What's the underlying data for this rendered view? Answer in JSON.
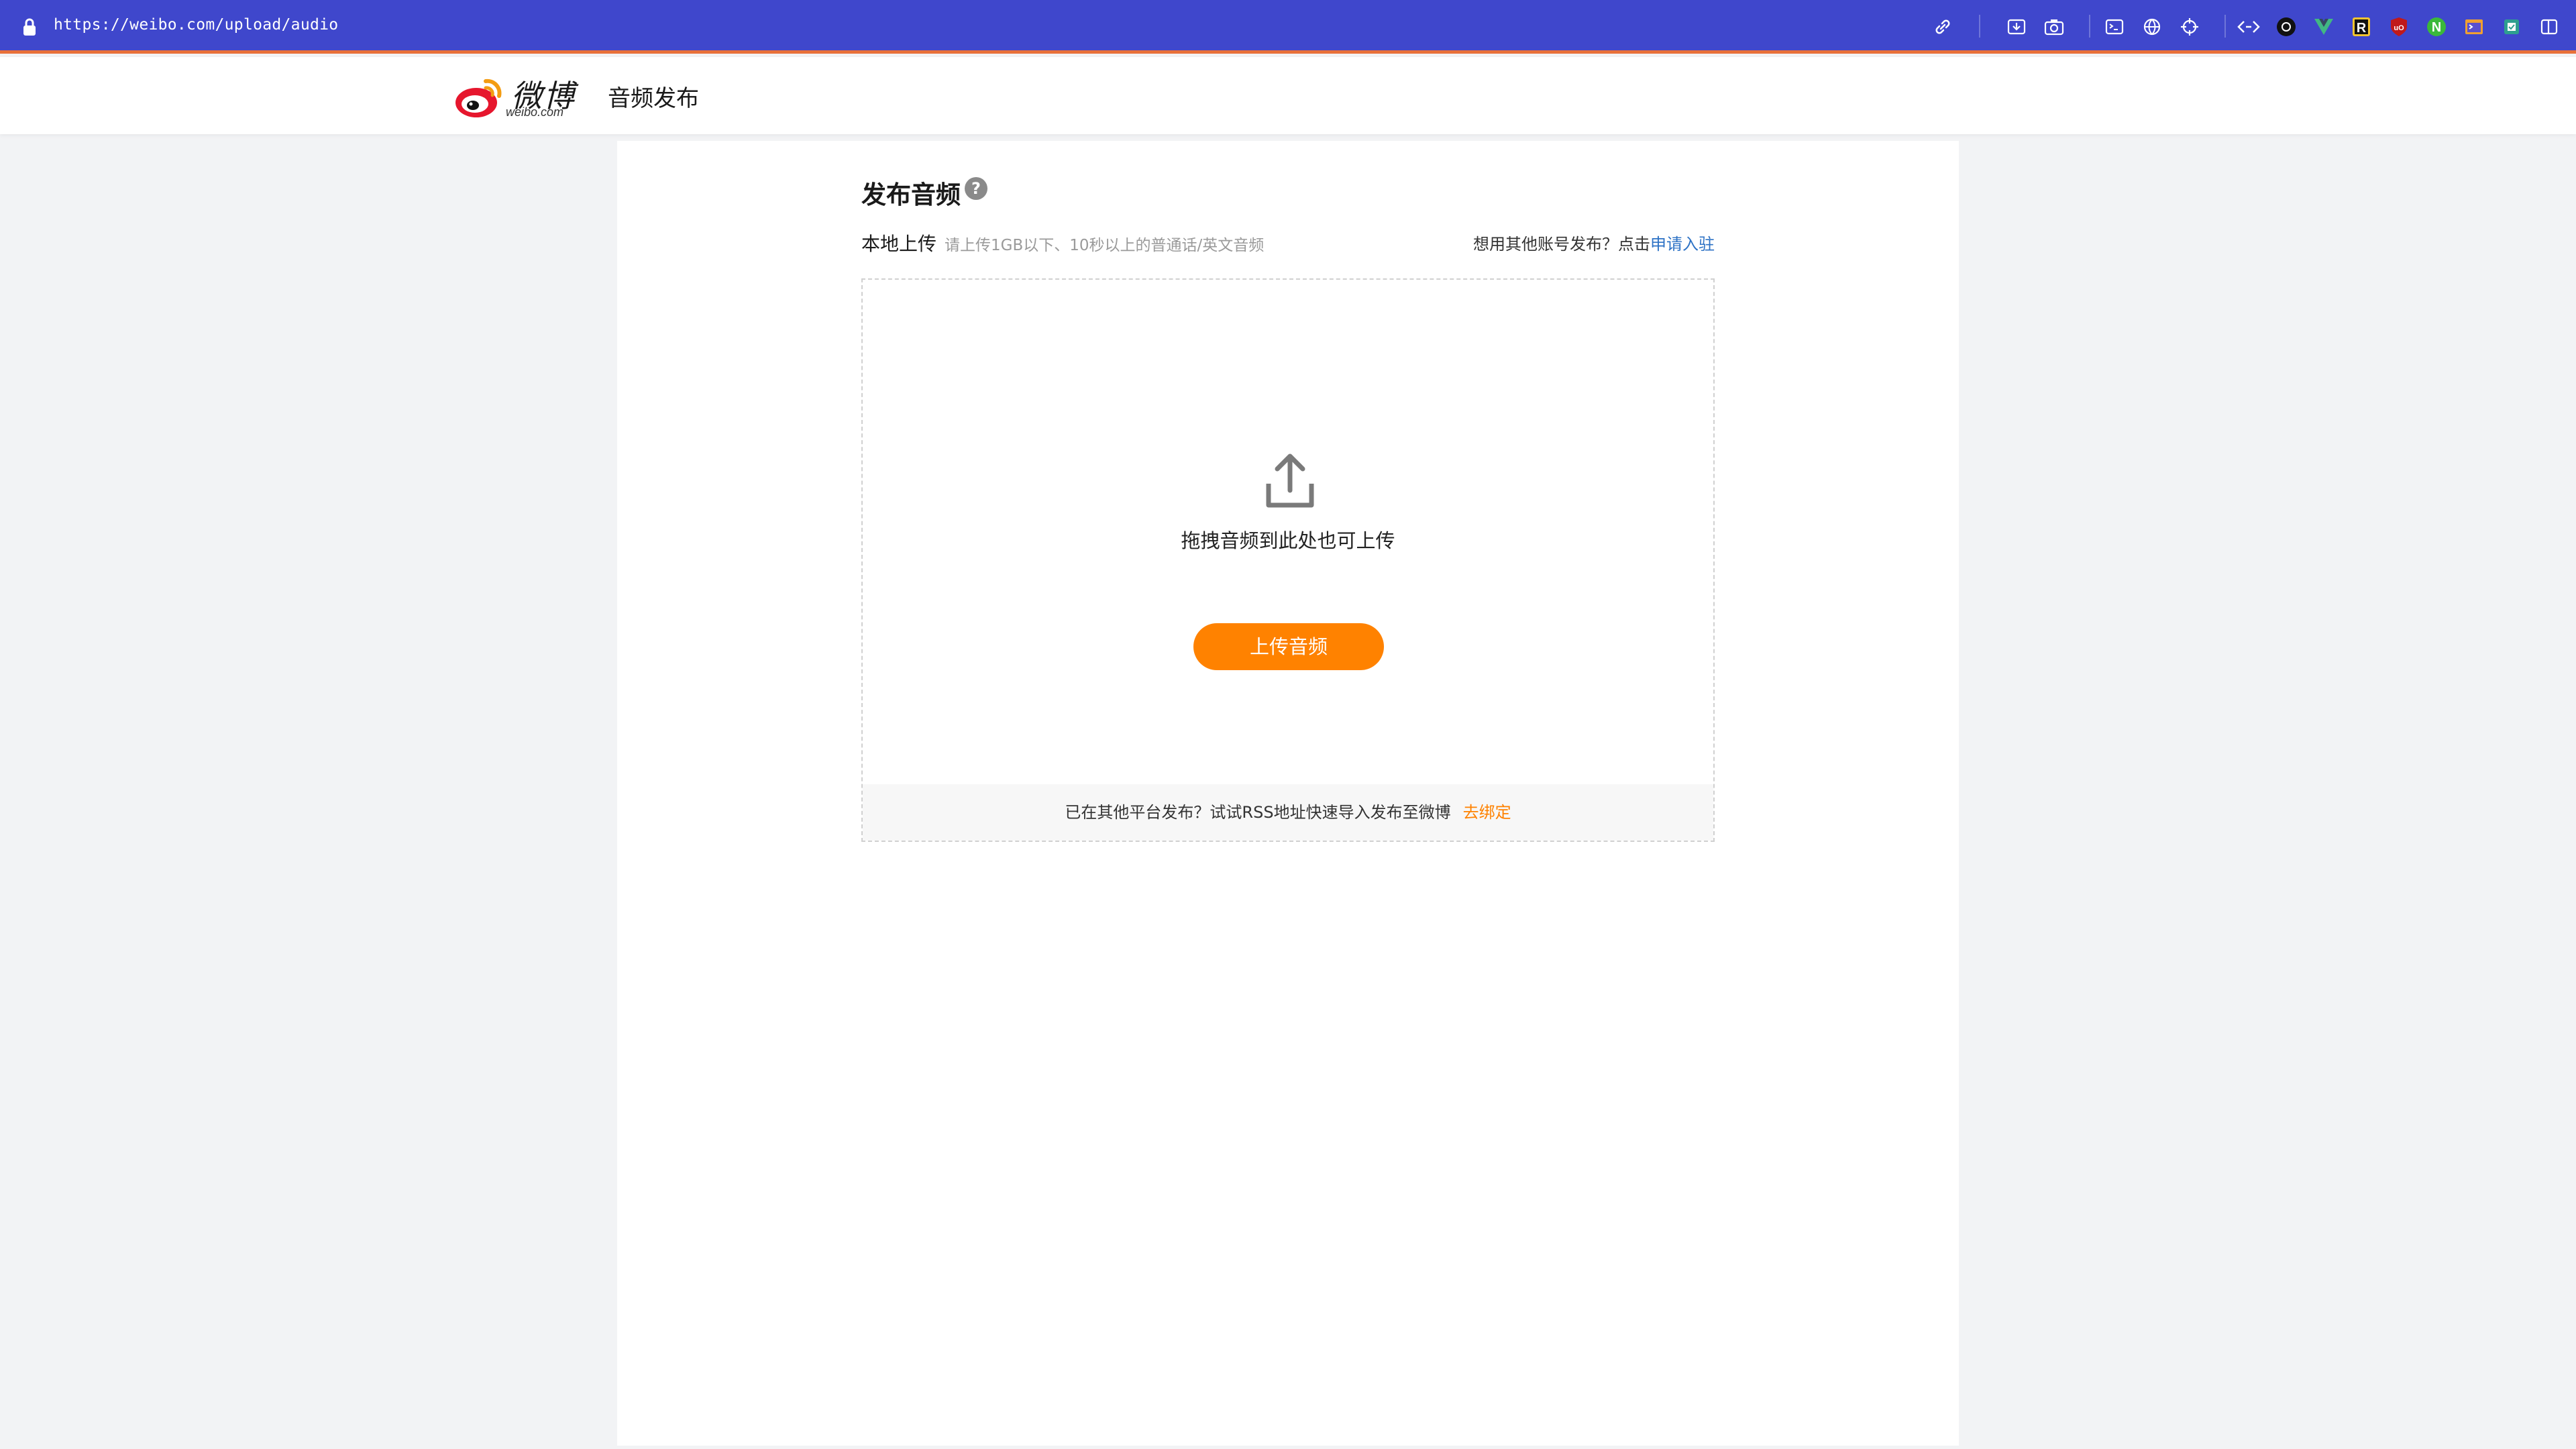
{
  "browser": {
    "url": "https://weibo.com/upload/audio",
    "extensions": [
      "link-icon",
      "download-icon",
      "camera-icon",
      "terminal-icon",
      "globe-icon",
      "crosshair-icon",
      "code-icon",
      "dark-circle-icon",
      "vue-icon",
      "r-icon",
      "ublock-icon",
      "n-icon",
      "screenshot-icon",
      "note-icon",
      "sidebar-icon"
    ]
  },
  "header": {
    "logo_cn": "微博",
    "logo_en": "weibo.com",
    "title": "音频发布"
  },
  "main": {
    "page_title": "发布音频",
    "help_glyph": "?",
    "local_upload_label": "本地上传",
    "upload_hint": "请上传1GB以下、10秒以上的普通话/英文音频",
    "other_account_text": "想用其他账号发布？点击",
    "apply_link": "申请入驻",
    "drop_text": "拖拽音频到此处也可上传",
    "upload_button": "上传音频",
    "rss_text": "已在其他平台发布？试试RSS地址快速导入发布至微博",
    "bind_link": "去绑定"
  },
  "colors": {
    "browser_bar": "#3f47cc",
    "accent_orange": "#ff8200",
    "link_blue": "#2d72c5"
  }
}
